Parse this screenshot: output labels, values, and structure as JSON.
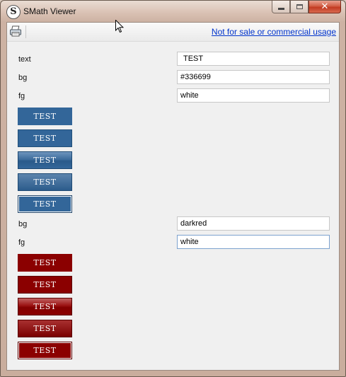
{
  "window": {
    "title": "SMath Viewer",
    "icon_letter": "S",
    "close_glyph": "✕"
  },
  "toolbar": {
    "print_icon": "printer-icon",
    "link_text": "Not for sale or commercial usage"
  },
  "form": {
    "text_label": "text",
    "text_value": "TEST",
    "bg_label": "bg",
    "bg_value": "#336699",
    "fg_label": "fg",
    "fg_value": "white",
    "bg2_label": "bg",
    "bg2_value": "darkred",
    "fg2_label": "fg",
    "fg2_value": "white"
  },
  "blue_buttons": [
    "TEST",
    "TEST",
    "TEST",
    "TEST",
    "TEST"
  ],
  "red_buttons": [
    "TEST",
    "TEST",
    "TEST",
    "TEST",
    "TEST"
  ],
  "colors": {
    "blue": "#336699",
    "darkred": "#8b0000",
    "link": "#0033cc"
  }
}
